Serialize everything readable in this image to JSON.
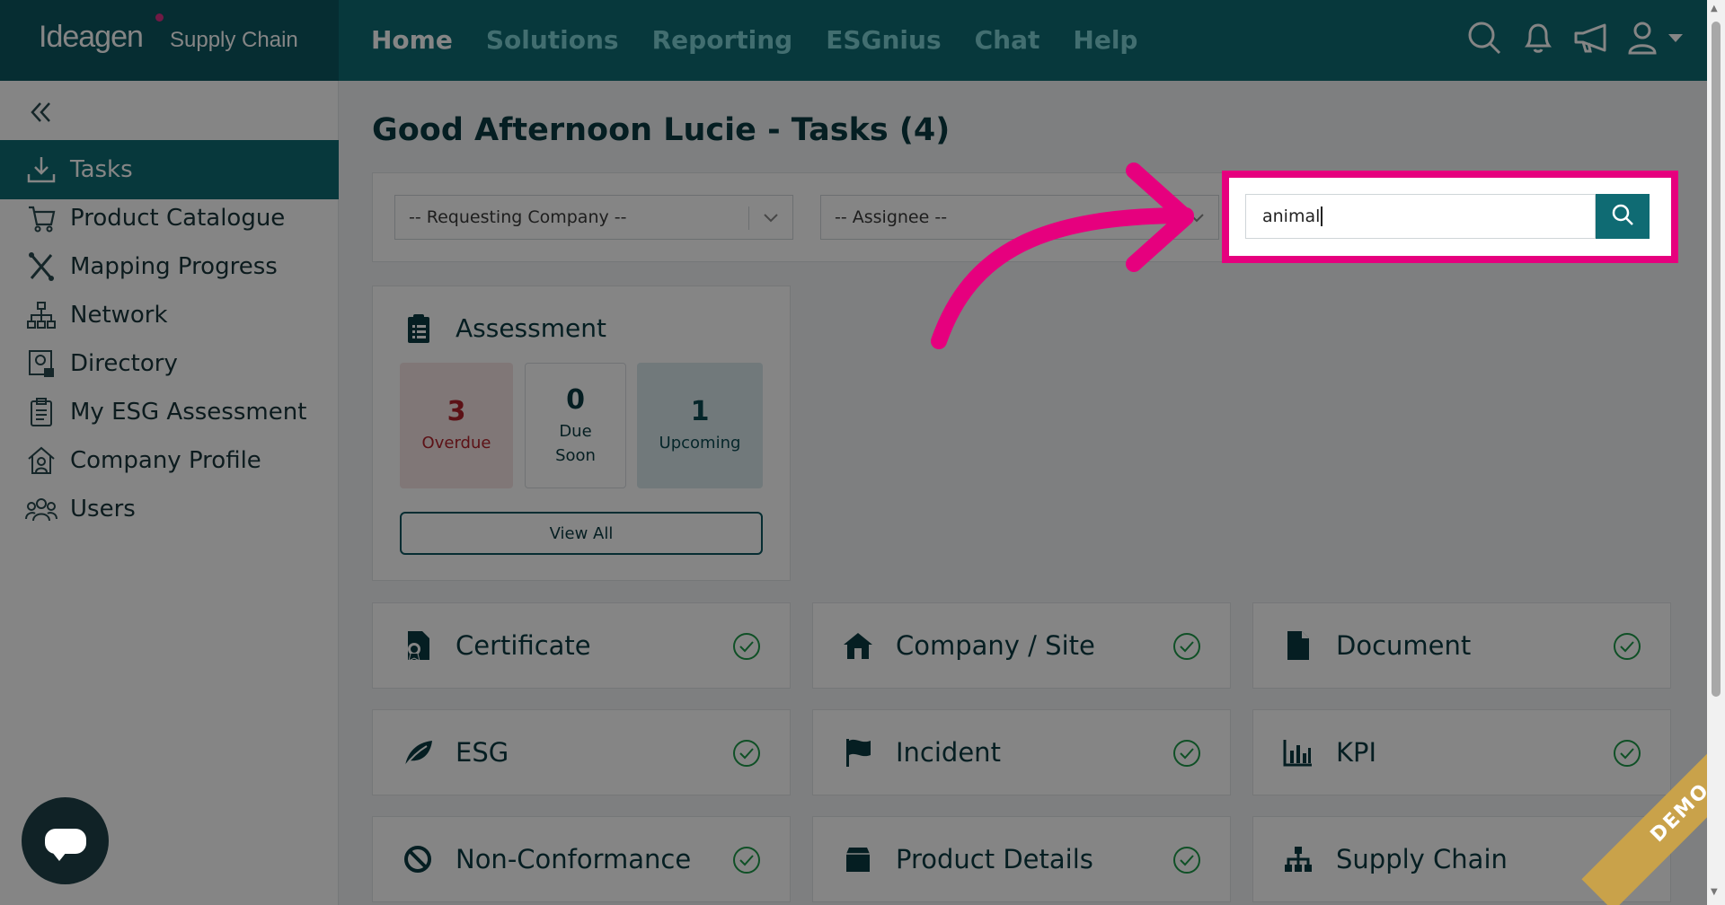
{
  "brand": {
    "name": "Ideagen",
    "product": "Supply Chain"
  },
  "nav": {
    "items": [
      {
        "label": "Home",
        "active": true
      },
      {
        "label": "Solutions",
        "active": false
      },
      {
        "label": "Reporting",
        "active": false
      },
      {
        "label": "ESGnius",
        "active": false
      },
      {
        "label": "Chat",
        "active": false
      },
      {
        "label": "Help",
        "active": false
      }
    ]
  },
  "top_icons": [
    "search-icon",
    "bell-icon",
    "megaphone-icon",
    "user-icon",
    "caret-down-icon"
  ],
  "sidebar": {
    "items": [
      {
        "label": "Tasks",
        "icon": "download-tray-icon",
        "active": true
      },
      {
        "label": "Product Catalogue",
        "icon": "cart-icon",
        "active": false
      },
      {
        "label": "Mapping Progress",
        "icon": "mapping-icon",
        "active": false
      },
      {
        "label": "Network",
        "icon": "network-icon",
        "active": false
      },
      {
        "label": "Directory",
        "icon": "directory-icon",
        "active": false
      },
      {
        "label": "My ESG Assessment",
        "icon": "clipboard-icon",
        "active": false
      },
      {
        "label": "Company Profile",
        "icon": "company-icon",
        "active": false
      },
      {
        "label": "Users",
        "icon": "users-icon",
        "active": false
      }
    ]
  },
  "main": {
    "greeting": "Good Afternoon Lucie - Tasks (4)",
    "filters": {
      "requesting_company": "-- Requesting Company --",
      "assignee": "-- Assignee --",
      "search_value": "animal"
    },
    "assessment": {
      "title": "Assessment",
      "overdue": {
        "value": "3",
        "label": "Overdue"
      },
      "due_soon": {
        "value": "0",
        "label_line1": "Due",
        "label_line2": "Soon"
      },
      "upcoming": {
        "value": "1",
        "label": "Upcoming"
      },
      "view_all": "View All"
    },
    "tiles": [
      {
        "label": "Certificate",
        "icon": "certificate-icon"
      },
      {
        "label": "Company / Site",
        "icon": "home-icon"
      },
      {
        "label": "Document",
        "icon": "document-icon"
      },
      {
        "label": "ESG",
        "icon": "leaf-icon"
      },
      {
        "label": "Incident",
        "icon": "flag-icon"
      },
      {
        "label": "KPI",
        "icon": "bar-chart-icon"
      },
      {
        "label": "Non-Conformance",
        "icon": "ban-icon"
      },
      {
        "label": "Product Details",
        "icon": "box-icon"
      },
      {
        "label": "Supply Chain",
        "icon": "hierarchy-icon"
      }
    ]
  },
  "ribbon": "DEMO",
  "colors": {
    "brand_dark": "#0c5660",
    "brand": "#0f6b73",
    "highlight": "#e6007e",
    "overdue": "#b0222b"
  }
}
